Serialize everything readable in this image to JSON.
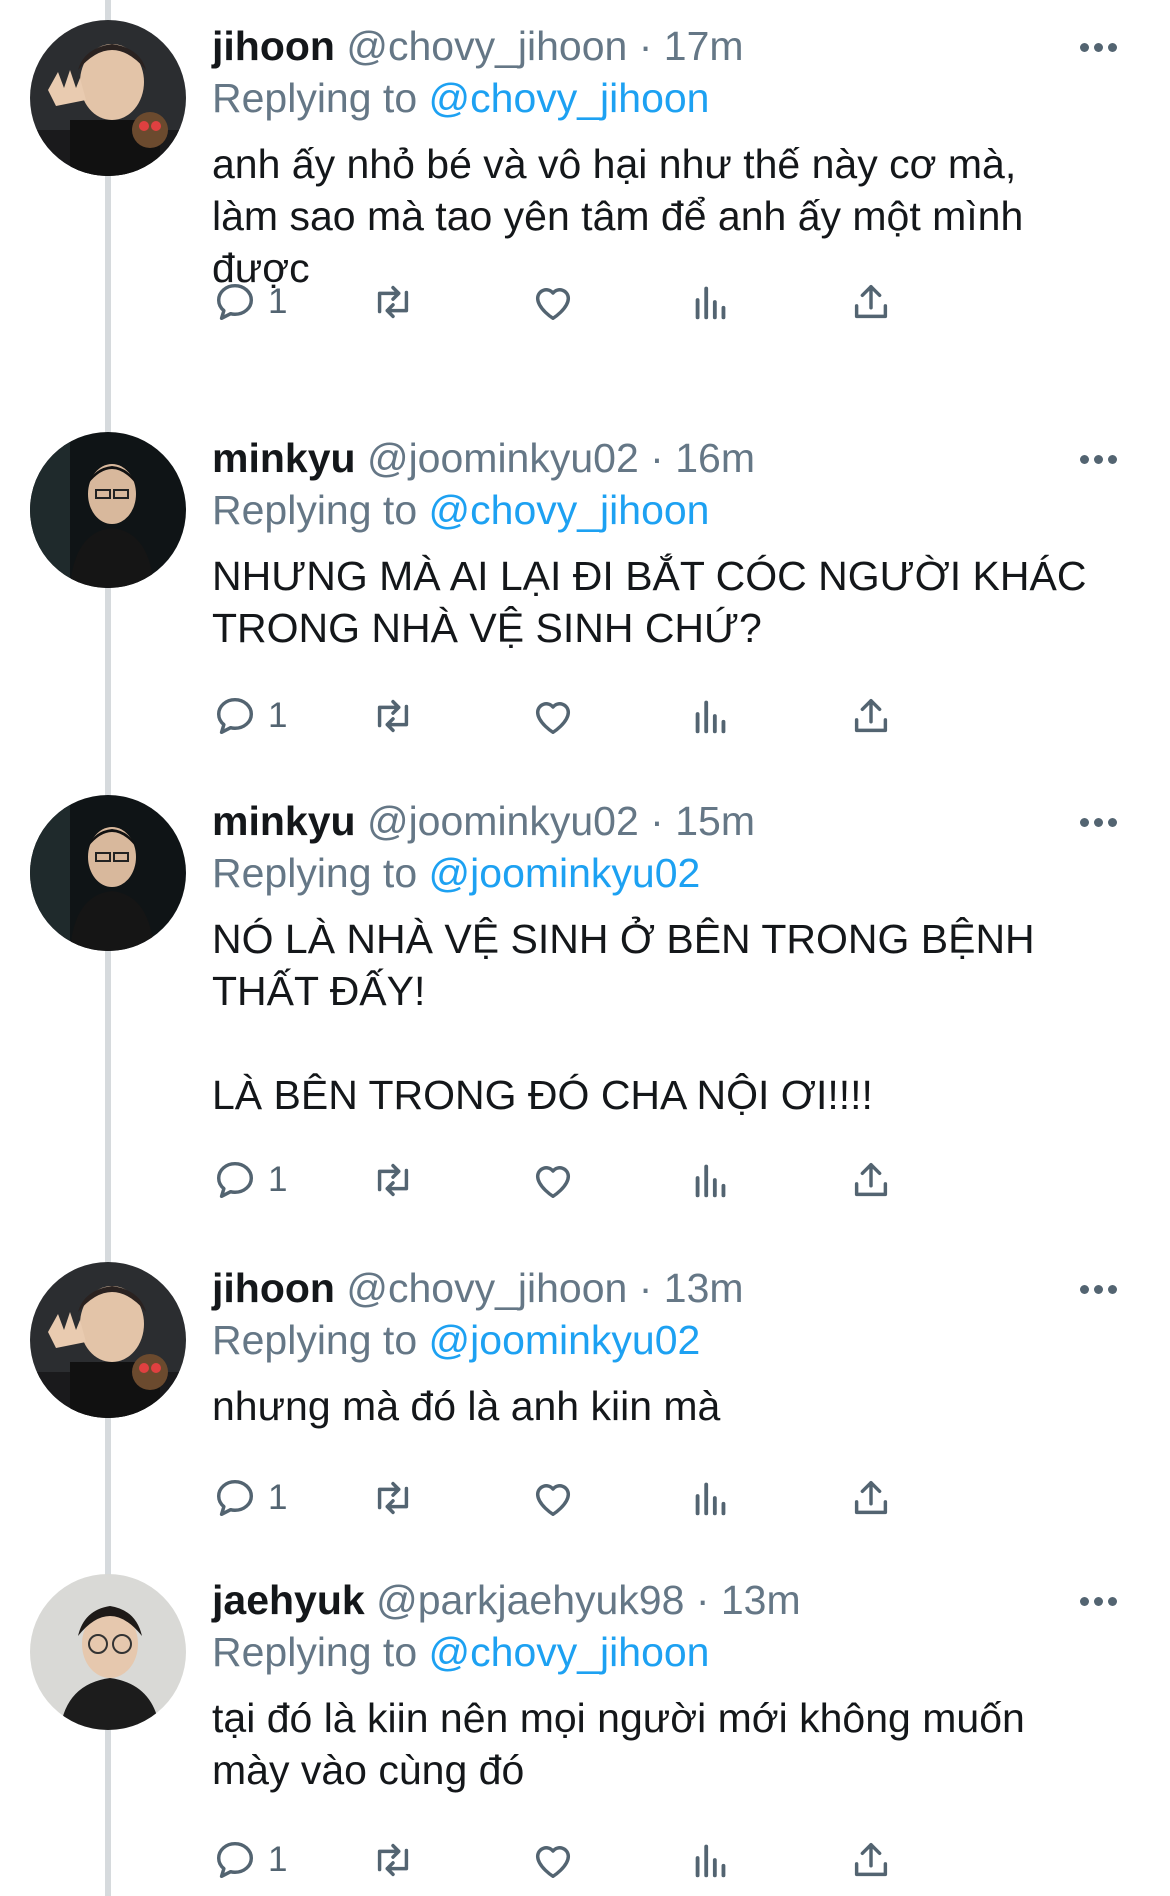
{
  "colors": {
    "accent": "#1da1f2",
    "meta": "#657786",
    "thread_line": "#d6dadd"
  },
  "tweets": [
    {
      "name": "jihoon",
      "handle": "@chovy_jihoon",
      "time": "· 17m",
      "replying_prefix": "Replying to",
      "replying_to": "@chovy_jihoon",
      "text": "anh ấy nhỏ bé và vô hại như thế này cơ mà,\nlàm sao mà tao yên tâm để anh ấy một mình\nđược",
      "reply_count": "1"
    },
    {
      "name": "minkyu",
      "handle": "@joominkyu02",
      "time": "· 16m",
      "replying_prefix": "Replying to",
      "replying_to": "@chovy_jihoon",
      "text": "NHƯNG MÀ AI LẠI ĐI BẮT CÓC NGƯỜI KHÁC\nTRONG NHÀ VỆ SINH CHỨ?",
      "reply_count": "1"
    },
    {
      "name": "minkyu",
      "handle": "@joominkyu02",
      "time": "· 15m",
      "replying_prefix": "Replying to",
      "replying_to": "@joominkyu02",
      "text": "NÓ LÀ NHÀ VỆ SINH Ở BÊN TRONG BỆNH\nTHẤT ĐẤY!\n\nLÀ BÊN TRONG ĐÓ CHA NỘI ƠI!!!!",
      "reply_count": "1"
    },
    {
      "name": "jihoon",
      "handle": "@chovy_jihoon",
      "time": "· 13m",
      "replying_prefix": "Replying to",
      "replying_to": "@joominkyu02",
      "text": "nhưng mà đó là anh kiin mà",
      "reply_count": "1"
    },
    {
      "name": "jaehyuk",
      "handle": "@parkjaehyuk98",
      "time": "· 13m",
      "replying_prefix": "Replying to",
      "replying_to": "@chovy_jihoon",
      "text": "tại đó là kiin nên mọi người mới không muốn\nmày vào cùng đó",
      "reply_count": "1"
    }
  ],
  "icons": [
    "reply-icon",
    "retweet-icon",
    "like-icon",
    "views-icon",
    "share-icon",
    "more-icon"
  ]
}
